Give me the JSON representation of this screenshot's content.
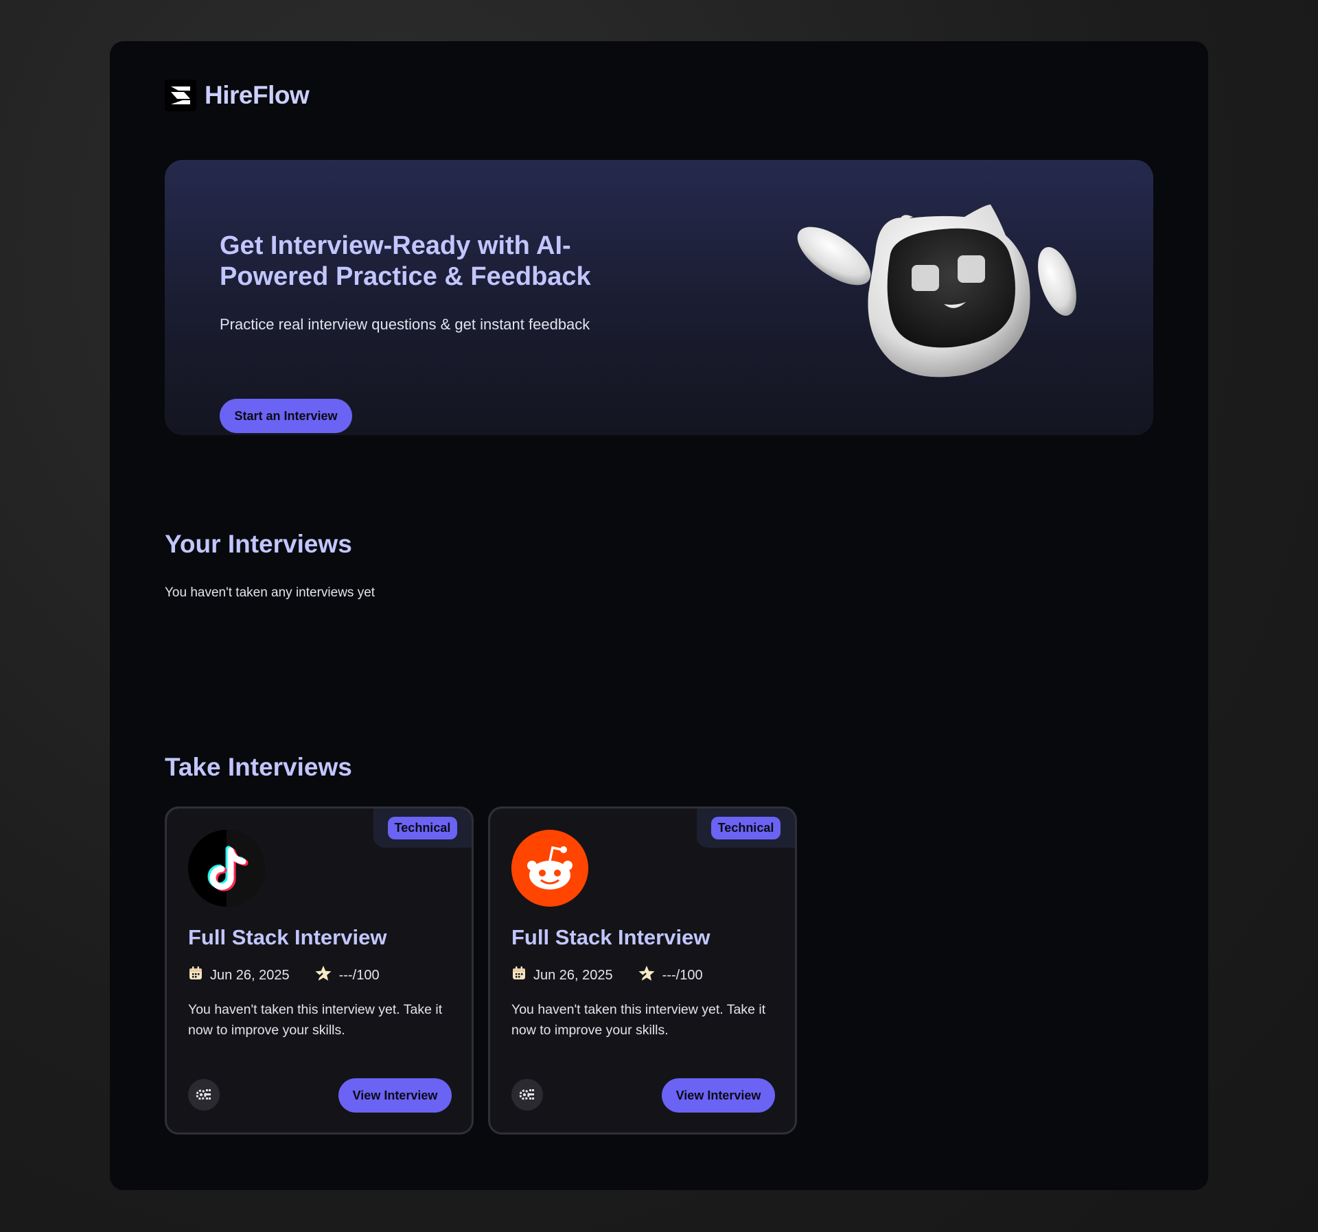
{
  "brand": {
    "name": "HireFlow"
  },
  "hero": {
    "title": "Get Interview-Ready with AI-Powered Practice & Feedback",
    "subtitle": "Practice real interview questions & get instant feedback",
    "cta_label": "Start an Interview"
  },
  "your_interviews": {
    "title": "Your Interviews",
    "empty_text": "You haven't taken any interviews yet"
  },
  "take_interviews": {
    "title": "Take Interviews",
    "cards": [
      {
        "company_icon": "tiktok-logo",
        "tag": "Technical",
        "title": "Full Stack Interview",
        "date": "Jun 26, 2025",
        "score": "---/100",
        "description": "You haven't taken this interview yet. Take it now to improve your skills.",
        "button_label": "View Interview"
      },
      {
        "company_icon": "reddit-logo",
        "tag": "Technical",
        "title": "Full Stack Interview",
        "date": "Jun 26, 2025",
        "score": "---/100",
        "description": "You haven't taken this interview yet. Take it now to improve your skills.",
        "button_label": "View Interview"
      }
    ]
  },
  "colors": {
    "accent": "#6a63f3",
    "heading": "#c2c6ff",
    "background": "#08090c"
  }
}
